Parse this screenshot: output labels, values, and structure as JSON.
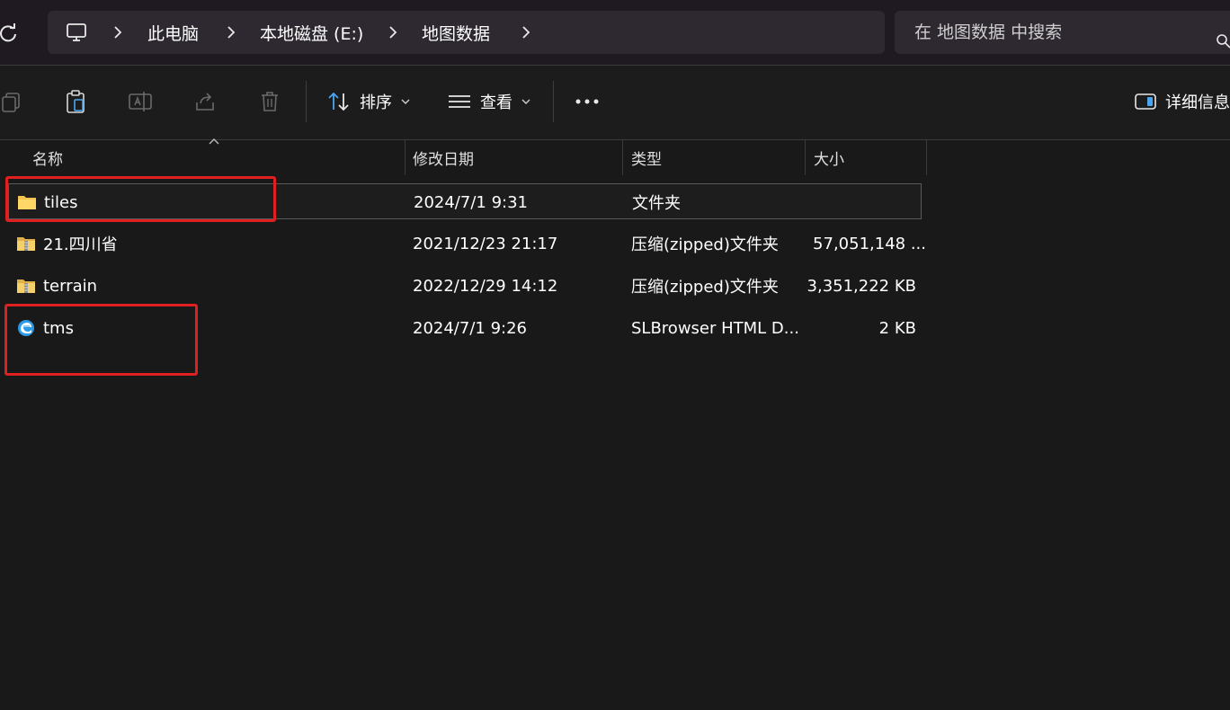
{
  "breadcrumb": {
    "items": [
      "此电脑",
      "本地磁盘 (E:)",
      "地图数据"
    ]
  },
  "search": {
    "placeholder": "在 地图数据 中搜索"
  },
  "toolbar": {
    "sort_label": "排序",
    "view_label": "查看",
    "details_label": "详细信息"
  },
  "columns": {
    "name": "名称",
    "modified": "修改日期",
    "type": "类型",
    "size": "大小"
  },
  "files": [
    {
      "name": "tiles",
      "modified": "2024/7/1 9:31",
      "type": "文件夹",
      "size": "",
      "icon": "folder-icon"
    },
    {
      "name": "21.四川省",
      "modified": "2021/12/23 21:17",
      "type": "压缩(zipped)文件夹",
      "size": "57,051,148 ...",
      "icon": "zip-folder-icon"
    },
    {
      "name": "terrain",
      "modified": "2022/12/29 14:12",
      "type": "压缩(zipped)文件夹",
      "size": "3,351,222 KB",
      "icon": "zip-folder-icon"
    },
    {
      "name": "tms",
      "modified": "2024/7/1 9:26",
      "type": "SLBrowser HTML D...",
      "size": "2 KB",
      "icon": "browser-html-icon"
    }
  ],
  "colors": {
    "annotation": "#e02020",
    "background": "#191919",
    "accent": "#2b9be8"
  }
}
